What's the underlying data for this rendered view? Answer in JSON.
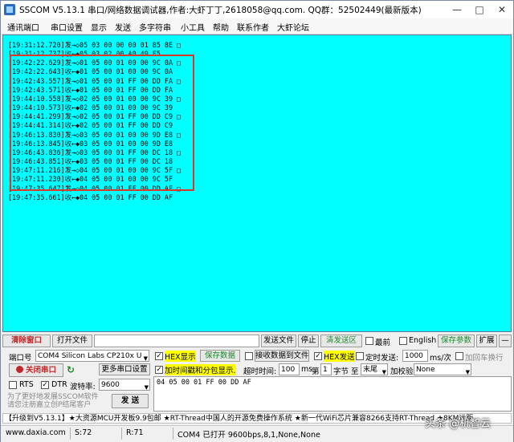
{
  "window": {
    "title": "SSCOM V5.13.1 串口/网络数据调试器,作者:大虾丁丁,2618058@qq.com. QQ群：52502449(最新版本)",
    "minimize": "—",
    "maximize": "□",
    "close": "✕"
  },
  "menu": [
    "通讯端口",
    "串口设置",
    "显示",
    "发送",
    "多字符串",
    "小工具",
    "帮助",
    "联系作者",
    "大虾论坛"
  ],
  "receive_lines": [
    "[19:31:12.720]发→◇05 03 00 00 00 01 85 8E □",
    "[19:31:12.737]收←◆05 03 02 00 A0 49 F5",
    "[19:42:22.629]发→◇01 05 00 01 00 00 9C 0A □",
    "[19:42:22.643]收←◆01 05 00 01 00 00 9C 0A",
    "[19:42:43.557]发→◇01 05 00 01 FF 00 DD FA □",
    "[19:42:43.571]收←◆01 05 00 01 FF 00 DD FA",
    "[19:44:10.558]发→◇02 05 00 01 00 00 9C 39 □",
    "[19:44:10.573]收←◆02 05 00 01 00 00 9C 39",
    "[19:44:41.299]发→◇02 05 00 01 FF 00 DD C9 □",
    "[19:44:41.314]收←◆02 05 00 01 FF 00 DD C9",
    "[19:46:13.830]发→◇03 05 00 01 00 00 9D E8 □",
    "[19:46:13.845]收←◆03 05 00 01 00 00 9D E8",
    "[19:46:43.836]发→◇03 05 00 01 FF 00 DC 18 □",
    "[19:46:43.851]收←◆03 05 00 01 FF 00 DC 18",
    "[19:47:11.216]发→◇04 05 00 01 00 00 9C 5F □",
    "[19:47:11.230]收←◆04 05 00 01 00 00 9C 5F",
    "[19:47:35.647]发→◇04 05 00 01 FF 00 DD AF □",
    "[19:47:35.661]收←◆04 05 00 01 FF 00 DD AF"
  ],
  "row1": {
    "clear_window": "清除窗口",
    "open_file": "打开文件",
    "send_file": "发送文件",
    "stop": "停止",
    "clear_send": "清发送区",
    "top_most": "最前",
    "english": "English",
    "save_params": "保存参数",
    "expand": "扩展",
    "dash": "—"
  },
  "row2": {
    "port_label": "端口号",
    "port_value": "COM4 Silicon Labs CP210x U",
    "hex_display": "HEX显示",
    "save_data": "保存数据",
    "recv_to_file": "接收数据到文件",
    "hex_send": "HEX发送",
    "timed_send": "定时发送:",
    "interval": "1000",
    "interval_unit": "ms/次",
    "add_return": "加回车换行"
  },
  "row3": {
    "close_port": "关闭串口",
    "more_settings": "更多串口设置",
    "timestamp_split": "加时间戳和分包显示.",
    "timeout_label": "超时时间:",
    "timeout_value": "100",
    "timeout_unit": "ms",
    "nth_label": "第",
    "nth_value": "1",
    "byte_label": "字节",
    "to_label": "至",
    "end_value": "末尾",
    "checksum_label": "加校验",
    "checksum_value": "None"
  },
  "row4": {
    "rts": "RTS",
    "dtr": "DTR",
    "baud_label": "波特率:",
    "baud_value": "9600",
    "send_text": "04 05 00 01 FF 00 DD AF"
  },
  "row5": {
    "promo": "为了更好地发展SSCOM软件\n请您注册嘉立创P结尾客户",
    "send_button": "发  送"
  },
  "ticker": "【升级到V5.13.1】★大资源MCU开发板9.9包邮 ★RT-Thread中国人的开源免费操作系统 ★新一代WiFi芯片兼容8266支持RT-Thread ★8KM远距",
  "status": {
    "website": "www.daxia.com",
    "sent": "S:72",
    "received": "R:71",
    "port_state": "COM4 已打开  9600bps,8,1,None,None"
  },
  "watermark": "头条 @机智云"
}
